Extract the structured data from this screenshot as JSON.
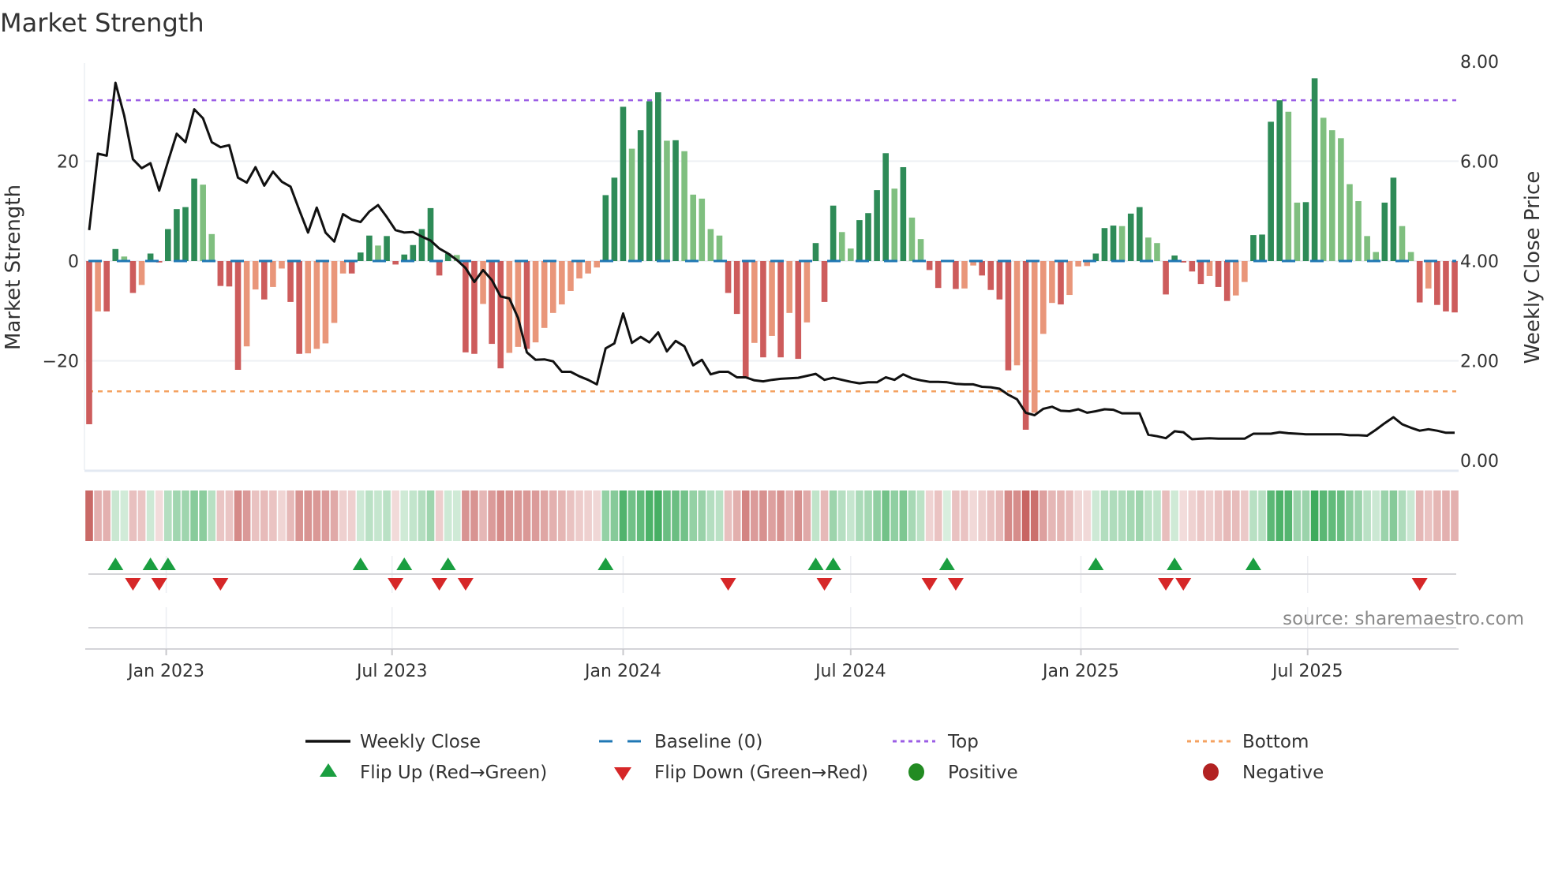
{
  "chart_data": {
    "type": "bar",
    "title": "Market Strength",
    "ylabel": "Market Strength",
    "y2label": "Weekly Close Price",
    "ylim": [
      -40,
      40
    ],
    "y2lim": [
      0,
      8
    ],
    "yticks": [
      {
        "value": 20,
        "label": "20"
      },
      {
        "value": 0,
        "label": "0"
      },
      {
        "value": -20,
        "label": "−20"
      }
    ],
    "y2ticks": [
      {
        "value": 8,
        "label": "8.00"
      },
      {
        "value": 6,
        "label": "6.00"
      },
      {
        "value": 4,
        "label": "4.00"
      },
      {
        "value": 2,
        "label": "2.00"
      },
      {
        "value": 0,
        "label": "0.00"
      }
    ],
    "xticks": [
      {
        "week": 8.8,
        "label": "Jan 2023"
      },
      {
        "week": 34.6,
        "label": "Jul 2023"
      },
      {
        "week": 61.0,
        "label": "Jan 2024"
      },
      {
        "week": 87.0,
        "label": "Jul 2024"
      },
      {
        "week": 113.3,
        "label": "Jan 2025"
      },
      {
        "week": 139.2,
        "label": "Jul 2025"
      }
    ],
    "top_level": 32.2,
    "bottom_level": -26.1,
    "baseline": 0,
    "strength": [
      -32.7,
      -10.1,
      -10.1,
      2.4,
      0.9,
      -6.4,
      -4.8,
      1.5,
      -0.3,
      6.4,
      10.4,
      10.8,
      16.5,
      15.3,
      5.4,
      -5.0,
      -5.1,
      -21.8,
      -17.1,
      -5.7,
      -7.7,
      -5.2,
      -1.5,
      -8.2,
      -18.6,
      -18.5,
      -17.6,
      -16.5,
      -12.4,
      -2.5,
      -2.5,
      1.7,
      5.1,
      3.1,
      5.0,
      -0.7,
      1.3,
      3.2,
      6.4,
      10.6,
      -2.9,
      1.5,
      1.2,
      -18.3,
      -18.6,
      -8.6,
      -16.6,
      -21.5,
      -18.4,
      -17.2,
      -17.6,
      -16.3,
      -13.4,
      -10.4,
      -8.7,
      -6.0,
      -3.5,
      -2.5,
      -1.3,
      13.2,
      16.7,
      30.9,
      22.5,
      26.2,
      32.0,
      33.8,
      24.1,
      24.2,
      22.0,
      13.3,
      12.5,
      6.4,
      5.1,
      -6.4,
      -10.6,
      -23.3,
      -16.4,
      -19.3,
      -15.0,
      -19.3,
      -10.4,
      -19.6,
      -12.3,
      3.6,
      -8.2,
      11.1,
      5.8,
      2.5,
      8.2,
      9.6,
      14.2,
      21.6,
      14.5,
      18.8,
      8.7,
      4.4,
      -1.8,
      -5.4,
      0.2,
      -5.6,
      -5.5,
      -0.9,
      -2.9,
      -5.8,
      -7.7,
      -21.9,
      -20.9,
      -33.8,
      -30.4,
      -14.6,
      -8.4,
      -8.7,
      -6.8,
      -1.1,
      -1.0,
      1.5,
      6.6,
      7.1,
      7.0,
      9.5,
      10.8,
      4.7,
      3.6,
      -6.7,
      1.1,
      -0.3,
      -2.1,
      -4.6,
      -3.0,
      -5.2,
      -8.0,
      -6.9,
      -4.2,
      5.2,
      5.3,
      27.9,
      32.2,
      29.9,
      11.7,
      11.8,
      36.6,
      28.7,
      26.2,
      24.6,
      15.4,
      12.0,
      5.0,
      1.8,
      11.7,
      16.7,
      7.0,
      1.8,
      -8.3,
      -5.5,
      -8.8,
      -10.1,
      -10.3
    ],
    "weekly_close": [
      4.62,
      6.15,
      6.11,
      7.57,
      6.91,
      6.04,
      5.86,
      5.96,
      5.41,
      5.99,
      6.55,
      6.38,
      7.04,
      6.86,
      6.38,
      6.28,
      6.32,
      5.67,
      5.57,
      5.88,
      5.51,
      5.79,
      5.59,
      5.49,
      5.02,
      4.57,
      5.07,
      4.57,
      4.39,
      4.94,
      4.83,
      4.78,
      4.99,
      5.12,
      4.88,
      4.62,
      4.57,
      4.58,
      4.49,
      4.41,
      4.25,
      4.15,
      4.02,
      3.86,
      3.58,
      3.82,
      3.62,
      3.29,
      3.25,
      2.86,
      2.17,
      2.02,
      2.03,
      1.99,
      1.78,
      1.78,
      1.69,
      1.62,
      1.53,
      2.25,
      2.35,
      2.95,
      2.36,
      2.48,
      2.37,
      2.57,
      2.19,
      2.4,
      2.29,
      1.91,
      2.02,
      1.73,
      1.78,
      1.78,
      1.67,
      1.67,
      1.61,
      1.59,
      1.62,
      1.64,
      1.65,
      1.66,
      1.7,
      1.74,
      1.62,
      1.66,
      1.62,
      1.58,
      1.55,
      1.57,
      1.57,
      1.67,
      1.62,
      1.73,
      1.65,
      1.61,
      1.58,
      1.58,
      1.57,
      1.54,
      1.53,
      1.53,
      1.48,
      1.47,
      1.44,
      1.32,
      1.23,
      0.96,
      0.91,
      1.04,
      1.08,
      1.0,
      0.99,
      1.03,
      0.96,
      0.99,
      1.03,
      1.02,
      0.95,
      0.95,
      0.95,
      0.52,
      0.49,
      0.45,
      0.59,
      0.57,
      0.43,
      0.44,
      0.45,
      0.44,
      0.44,
      0.44,
      0.44,
      0.54,
      0.54,
      0.54,
      0.57,
      0.55,
      0.54,
      0.53,
      0.53,
      0.53,
      0.53,
      0.53,
      0.51,
      0.51,
      0.5,
      0.62,
      0.75,
      0.87,
      0.73,
      0.66,
      0.6,
      0.63,
      0.6,
      0.56,
      0.56
    ],
    "legend": {
      "placement": "bottom",
      "items": [
        {
          "label": "Weekly Close",
          "kind": "line"
        },
        {
          "label": "Baseline (0)",
          "kind": "dash"
        },
        {
          "label": "Top",
          "kind": "dot"
        },
        {
          "label": "Bottom",
          "kind": "dot"
        },
        {
          "label": "Flip Up (Red→Green)",
          "kind": "triangle-up"
        },
        {
          "label": "Flip Down (Green→Red)",
          "kind": "triangle-down"
        },
        {
          "label": "Positive",
          "kind": "circle"
        },
        {
          "label": "Negative",
          "kind": "circle"
        }
      ]
    },
    "source": "source: sharemaestro.com"
  },
  "colors": {
    "pos_strong": "#2e8b57",
    "pos_weak": "#7fbf7f",
    "neg_strong": "#cd5c5c",
    "neg_weak": "#e9967a",
    "close": "#111111",
    "baseline": "#1f77b4",
    "top": "#9b5de5",
    "bottom": "#f4a261",
    "flip_up": "#1a9e40",
    "flip_down": "#d62728",
    "positive": "#228b22",
    "negative": "#b22222"
  }
}
